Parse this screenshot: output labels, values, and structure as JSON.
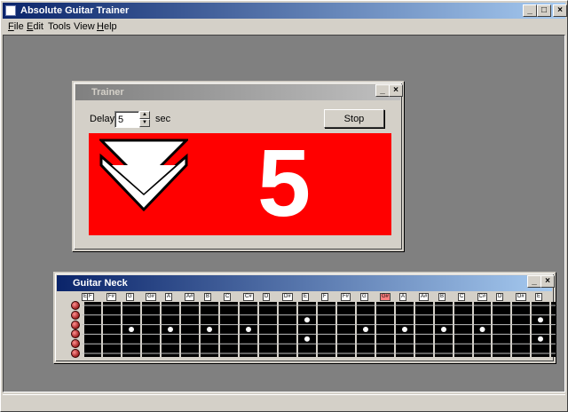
{
  "window": {
    "title": "Absolute Guitar Trainer",
    "buttons": [
      "_",
      "□",
      "×"
    ]
  },
  "menubar": {
    "items": [
      {
        "label": "File",
        "accel": "F",
        "rest": "ile"
      },
      {
        "label": "Edit",
        "accel": "E",
        "rest": "dit"
      },
      {
        "label": "Tools",
        "accel": "",
        "rest": "Tools"
      },
      {
        "label": "View",
        "accel": "",
        "rest": "View"
      },
      {
        "label": "Help",
        "accel": "H",
        "rest": "elp"
      }
    ]
  },
  "trainer": {
    "title": "Trainer",
    "delay_label": "Delay",
    "delay_value": "5",
    "unit_label": "sec",
    "stop_label": "Stop",
    "display_number": "5",
    "direction_icon": "double-chevron-down-icon",
    "colors": {
      "display_bg": "#ff0000",
      "foreground": "#ffffff"
    }
  },
  "guitar_neck": {
    "title": "Guitar Neck",
    "note_labels": [
      "E",
      "F",
      "F#",
      "G",
      "G#",
      "A",
      "A#",
      "B",
      "C",
      "C#",
      "D",
      "D#",
      "E",
      "F",
      "F#",
      "G",
      "G#",
      "A",
      "A#",
      "B",
      "C",
      "C#",
      "D",
      "D#",
      "E"
    ],
    "highlighted_fret": 16,
    "string_count": 6,
    "fret_count": 24,
    "marker_frets": [
      3,
      5,
      7,
      9,
      12,
      15,
      17,
      19,
      21,
      24
    ],
    "double_marker_frets": [
      12,
      24
    ],
    "colors": {
      "highlight": "#ff8080",
      "fretboard": "#000000"
    }
  }
}
